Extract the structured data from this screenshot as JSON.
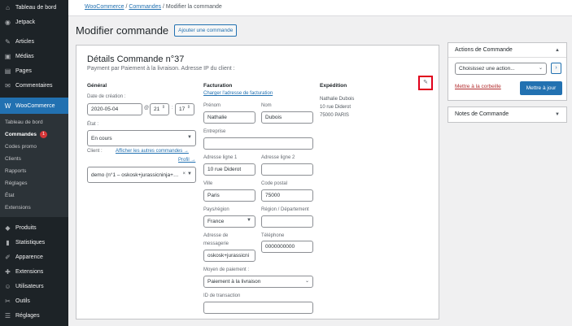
{
  "sidebar": {
    "top_items": [
      {
        "label": "Tableau de bord",
        "icon": "dashboard-icon",
        "glyph": "⌂"
      },
      {
        "label": "Jetpack",
        "icon": "jetpack-icon",
        "glyph": "◉"
      }
    ],
    "content_items": [
      {
        "label": "Articles",
        "icon": "pin-icon",
        "glyph": "✎"
      },
      {
        "label": "Médias",
        "icon": "media-icon",
        "glyph": "▣"
      },
      {
        "label": "Pages",
        "icon": "pages-icon",
        "glyph": "▤"
      },
      {
        "label": "Commentaires",
        "icon": "comments-icon",
        "glyph": "✉"
      }
    ],
    "active": {
      "label": "WooCommerce",
      "icon": "woocommerce-icon",
      "glyph": "W"
    },
    "submenu": [
      {
        "label": "Tableau de bord"
      },
      {
        "label": "Commandes",
        "badge": "1"
      },
      {
        "label": "Codes promo"
      },
      {
        "label": "Clients"
      },
      {
        "label": "Rapports"
      },
      {
        "label": "Réglages"
      },
      {
        "label": "État"
      },
      {
        "label": "Extensions"
      }
    ],
    "bottom_items": [
      {
        "label": "Produits",
        "icon": "products-icon",
        "glyph": "◆"
      },
      {
        "label": "Statistiques",
        "icon": "stats-icon",
        "glyph": "▮"
      },
      {
        "label": "Apparence",
        "icon": "appearance-icon",
        "glyph": "✐"
      },
      {
        "label": "Extensions",
        "icon": "plugins-icon",
        "glyph": "✚"
      },
      {
        "label": "Utilisateurs",
        "icon": "users-icon",
        "glyph": "☺"
      },
      {
        "label": "Outils",
        "icon": "tools-icon",
        "glyph": "✂"
      },
      {
        "label": "Réglages",
        "icon": "settings-icon",
        "glyph": "☰"
      }
    ]
  },
  "breadcrumb": {
    "first": "WooCommerce",
    "sep": "/",
    "second": "Commandes",
    "current": "Modifier la commande"
  },
  "page": {
    "title": "Modifier commande",
    "add_button": "Ajouter une commande"
  },
  "order": {
    "title": "Détails Commande n°37",
    "subtitle": "Payment par Paiement à la livraison. Adresse IP du client :",
    "general": {
      "heading": "Général",
      "date_label": "Date de création :",
      "date": "2020-05-04",
      "at": "@",
      "hour": "21",
      "colon": ":",
      "minute": "17",
      "status_label": "État :",
      "status": "En cours",
      "client_label": "Client :",
      "other_orders_link": "Afficher les autres commandes →",
      "profile_link": "Profil →",
      "client_value": "demo (n°1 – oskosk+jurassicninja+…",
      "clear": "×"
    },
    "billing": {
      "heading": "Facturation",
      "load_link": "Charger l'adresse de facturation",
      "first_name_label": "Prénom",
      "first_name": "Nathalie",
      "last_name_label": "Nom",
      "last_name": "Dubois",
      "company_label": "Entreprise",
      "company": "",
      "address1_label": "Adresse ligne 1",
      "address1": "10 rue Diderot",
      "address2_label": "Adresse ligne 2",
      "address2": "",
      "city_label": "Ville",
      "city": "Paris",
      "postcode_label": "Code postal",
      "postcode": "75000",
      "country_label": "Pays/région",
      "country": "France",
      "state_label": "Région / Département",
      "state": "",
      "email_label_1": "Adresse de",
      "email_label_2": "messagerie",
      "email": "oskosk+jurassicni",
      "phone_label": "Téléphone",
      "phone": "0000000000",
      "payment_label": "Moyen de paiement :",
      "payment": "Paiement à la livraison",
      "txn_label": "ID de transaction",
      "txn": ""
    },
    "shipping": {
      "heading": "Expédition",
      "line1": "Nathalie Dubois",
      "line2": "10 rue Diderot",
      "line3": "75000 PARIS"
    }
  },
  "actions_box": {
    "title": "Actions de Commande",
    "toggle": "▲",
    "select": "Choisissez une action...",
    "apply": "›",
    "trash": "Mettre à la corbeille",
    "update": "Mettre à jour"
  },
  "notes_box": {
    "title": "Notes de Commande",
    "toggle": "▼"
  },
  "colors": {
    "accent": "#2271b1",
    "sidebar": "#1d2327",
    "highlight": "#e0001b"
  }
}
